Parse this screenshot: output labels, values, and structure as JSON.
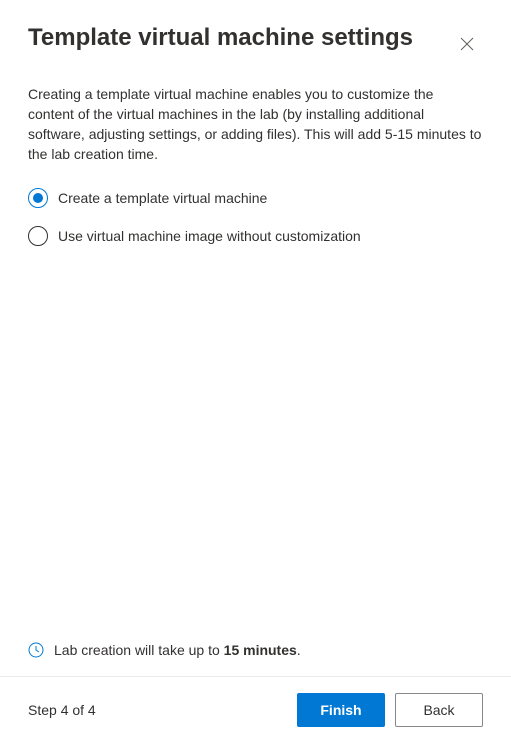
{
  "header": {
    "title": "Template virtual machine settings"
  },
  "body": {
    "description": "Creating a template virtual machine enables you to customize the content of the virtual machines in the lab (by installing additional software, adjusting settings, or adding files). This will add 5-15 minutes to the lab creation time.",
    "options": [
      {
        "label": "Create a template virtual machine",
        "selected": true
      },
      {
        "label": "Use virtual machine image without customization",
        "selected": false
      }
    ]
  },
  "info": {
    "text_prefix": "Lab creation will take up to ",
    "text_bold": "15 minutes",
    "text_suffix": "."
  },
  "footer": {
    "step_label": "Step 4 of 4",
    "primary_label": "Finish",
    "secondary_label": "Back"
  }
}
